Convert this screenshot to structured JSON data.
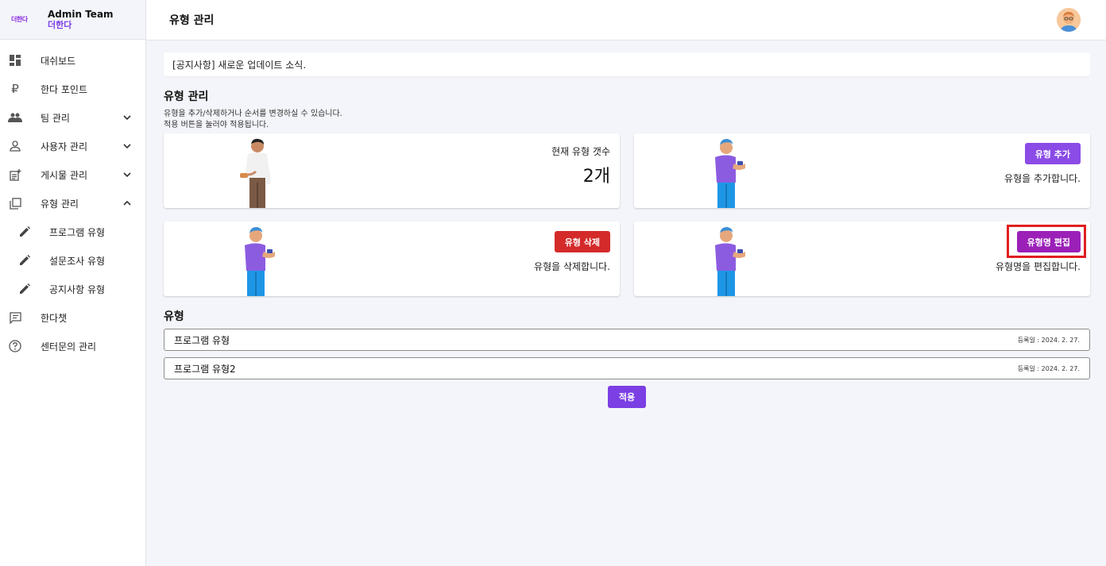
{
  "brand": {
    "logo_text": "더한다",
    "title": "Admin Team",
    "subtitle": "더한다"
  },
  "header": {
    "title": "유형 관리"
  },
  "sidebar": {
    "items": [
      {
        "label": "대쉬보드",
        "icon": "dashboard-icon"
      },
      {
        "label": "한다 포인트",
        "icon": "ruble-icon"
      },
      {
        "label": "팀 관리",
        "icon": "group-icon",
        "expand": "down"
      },
      {
        "label": "사용자 관리",
        "icon": "person-icon",
        "expand": "down"
      },
      {
        "label": "게시물 관리",
        "icon": "post-add-icon",
        "expand": "down"
      },
      {
        "label": "유형 관리",
        "icon": "library-icon",
        "expand": "up"
      }
    ],
    "sub_items": [
      {
        "label": "프로그램 유형",
        "icon": "pencil-icon"
      },
      {
        "label": "설문조사 유형",
        "icon": "pencil-icon"
      },
      {
        "label": "공지사항 유형",
        "icon": "pencil-icon"
      }
    ],
    "bottom_items": [
      {
        "label": "한다챗",
        "icon": "chat-icon"
      },
      {
        "label": "센터문의 관리",
        "icon": "help-icon"
      }
    ]
  },
  "notice": {
    "text": "[공지사항] 새로운 업데이트 소식."
  },
  "main": {
    "title": "유형 관리",
    "desc_line1": "유형을 추가/삭제하거나 순서를 변경하실 수 있습니다.",
    "desc_line2": "적용 버튼을 눌러야 적용됩니다."
  },
  "cards": {
    "count_label": "현재 유형 갯수",
    "count_value": "2개",
    "add_button": "유형 추가",
    "add_desc": "유형을 추가합니다.",
    "delete_button": "유형 삭제",
    "delete_desc": "유형을 삭제합니다.",
    "edit_button": "유형명 편집",
    "edit_desc": "유형명을 편집합니다."
  },
  "types": {
    "title": "유형",
    "rows": [
      {
        "name": "프로그램 유형",
        "date": "등록일 : 2024. 2. 27."
      },
      {
        "name": "프로그램 유형2",
        "date": "등록일 : 2024. 2. 27."
      }
    ]
  },
  "apply_button": "적용",
  "colors": {
    "accent": "#7b3fe4",
    "delete": "#d42a2a",
    "edit": "#9b20b8",
    "highlight": "#e01f1f"
  }
}
